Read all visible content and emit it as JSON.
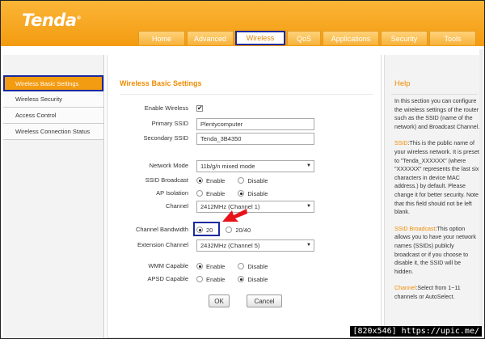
{
  "brand": {
    "logo_text": "Tenda",
    "logo_mark": "®"
  },
  "nav": {
    "tabs": [
      {
        "label": "Home"
      },
      {
        "label": "Advanced"
      },
      {
        "label": "Wireless"
      },
      {
        "label": "QoS"
      },
      {
        "label": "Applications"
      },
      {
        "label": "Security"
      },
      {
        "label": "Tools"
      }
    ],
    "active_tab": "Wireless"
  },
  "sidebar": {
    "items": [
      {
        "label": "Wireless Basic Settings"
      },
      {
        "label": "Wireless Security"
      },
      {
        "label": "Access Control"
      },
      {
        "label": "Wireless Connection Status"
      }
    ],
    "active_item": "Wireless Basic Settings"
  },
  "main": {
    "title": "Wireless Basic Settings",
    "enable_wireless": {
      "label": "Enable Wireless",
      "checked": true,
      "check_glyph": "✔"
    },
    "primary_ssid": {
      "label": "Primary SSID",
      "value": "Plentycomputer"
    },
    "secondary_ssid": {
      "label": "Secondary SSID",
      "value": "Tenda_3B4350"
    },
    "network_mode": {
      "label": "Network Mode",
      "value": "11b/g/n mixed mode"
    },
    "ssid_broadcast": {
      "label": "SSID Broadcast",
      "options": [
        "Enable",
        "Disable"
      ],
      "selected": "Enable"
    },
    "ap_isolation": {
      "label": "AP Isolation",
      "options": [
        "Enable",
        "Disable"
      ],
      "selected": "Disable"
    },
    "channel": {
      "label": "Channel",
      "value": "2412MHz (Channel 1)"
    },
    "channel_bandwidth": {
      "label": "Channel Bandwidth",
      "options": [
        "20",
        "20/40"
      ],
      "selected": "20"
    },
    "extension_channel": {
      "label": "Extension Channel",
      "value": "2432MHz (Channel 5)"
    },
    "wmm_capable": {
      "label": "WMM Capable",
      "options": [
        "Enable",
        "Disable"
      ],
      "selected": "Enable"
    },
    "apsd_capable": {
      "label": "APSD Capable",
      "options": [
        "Enable",
        "Disable"
      ],
      "selected": "Disable"
    },
    "ok_label": "OK",
    "cancel_label": "Cancel"
  },
  "help": {
    "title": "Help",
    "intro": "In this section you can configure the wireless settings of the router such as the SSID (name of the network) and Broadcast Channel.",
    "ssid_key": "SSID",
    "ssid_text": ":This is the public name of your wireless network. It is preset to \"Tenda_XXXXXX\" (where \"XXXXXX\" represents the last six characters in device MAC address.) by default. Please change it for better security. Note that this field should not be left blank.",
    "bcast_key": "SSID Broadcast",
    "bcast_text": ":This option allows you to have your network names (SSIDs) publicly broadcast or if you choose to disable it, the SSID will be hidden.",
    "channel_key": "Channel",
    "channel_text": ":Select from 1~11 channels or AutoSelect."
  },
  "watermark": "[820x546] https://upic.me/",
  "colors": {
    "brand_orange": "#f39b11",
    "highlight_blue": "#1a2aa0",
    "pointer_red": "#e8121b"
  },
  "icons": {
    "pointer": "red-arrow-icon",
    "check": "checkbox-icon"
  }
}
